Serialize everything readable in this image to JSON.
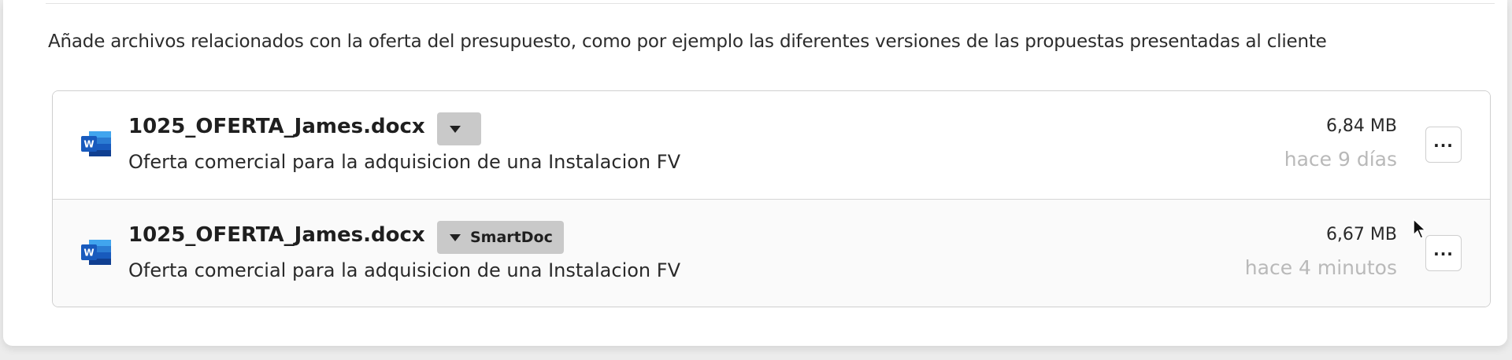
{
  "section": {
    "description": "Añade archivos relacionados con la oferta del presupuesto, como por ejemplo las diferentes versiones de las propuestas presentadas al cliente"
  },
  "files": [
    {
      "name": "1025_OFERTA_James.docx",
      "tag_label": "",
      "description": "Oferta comercial para la adquisicion de una Instalacion FV",
      "size": "6,84 MB",
      "time": "hace 9 días",
      "icon": "word-icon",
      "more_label": "..."
    },
    {
      "name": "1025_OFERTA_James.docx",
      "tag_label": "SmartDoc",
      "description": "Oferta comercial para la adquisicion de una Instalacion FV",
      "size": "6,67 MB",
      "time": "hace 4 minutos",
      "icon": "word-icon",
      "more_label": "..."
    }
  ],
  "colors": {
    "word_blue_dark": "#185abd",
    "word_blue_light": "#41a5ee",
    "tag_bg": "#c9c9c9",
    "muted_text": "#b9b9b9"
  }
}
